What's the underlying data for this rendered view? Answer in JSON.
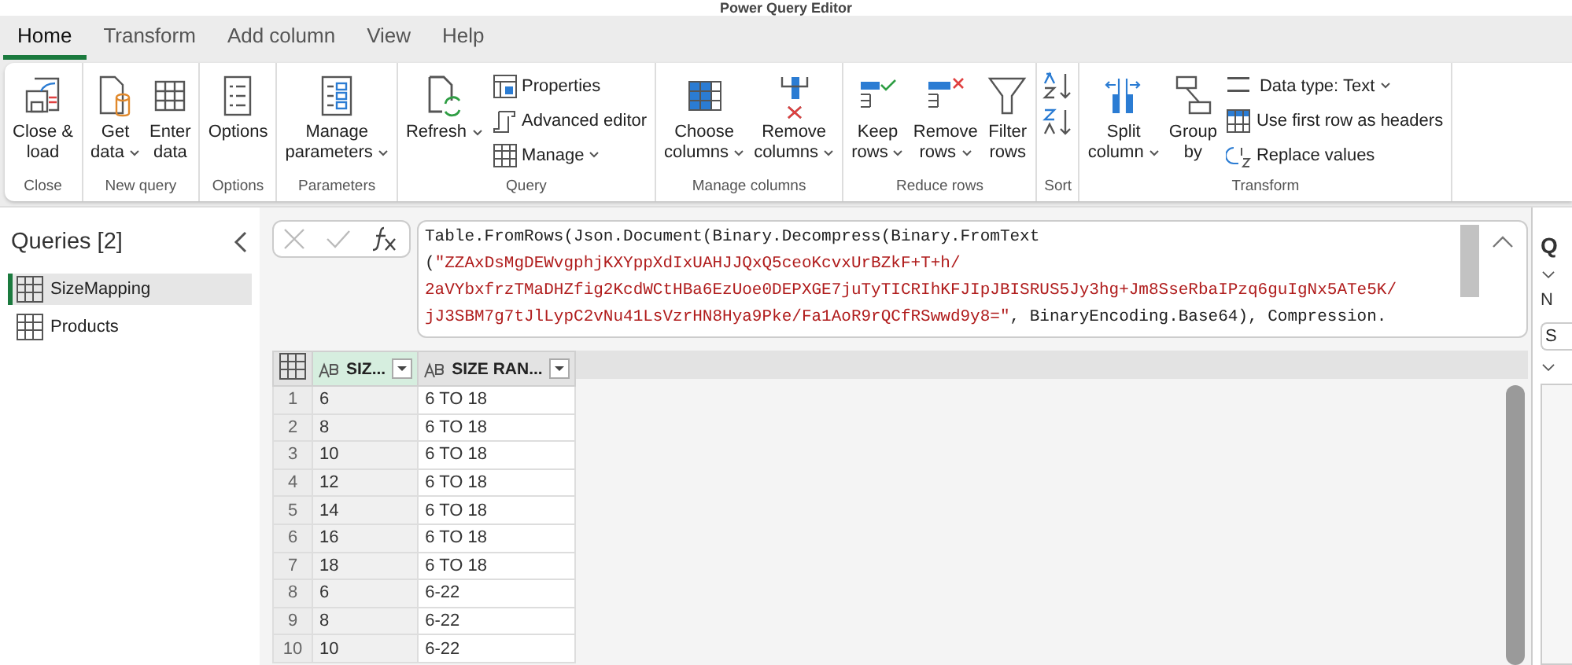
{
  "window": {
    "title": "Power Query Editor"
  },
  "tabs": [
    {
      "label": "Home",
      "selected": true
    },
    {
      "label": "Transform",
      "selected": false
    },
    {
      "label": "Add column",
      "selected": false
    },
    {
      "label": "View",
      "selected": false
    },
    {
      "label": "Help",
      "selected": false
    }
  ],
  "ribbon": [
    {
      "label": "Close",
      "buttons": [
        {
          "kind": "large",
          "label": "Close &\nload",
          "dropdown": false
        }
      ]
    },
    {
      "label": "New query",
      "buttons": [
        {
          "kind": "large",
          "label": "Get\ndata",
          "dropdown": true
        },
        {
          "kind": "large",
          "label": "Enter\ndata",
          "dropdown": false
        }
      ]
    },
    {
      "label": "Options",
      "buttons": [
        {
          "kind": "large",
          "label": "Options",
          "dropdown": false
        }
      ]
    },
    {
      "label": "Parameters",
      "buttons": [
        {
          "kind": "large",
          "label": "Manage\nparameters",
          "dropdown": true
        }
      ]
    },
    {
      "label": "Query",
      "buttons": [
        {
          "kind": "large",
          "label": "Refresh",
          "dropdown": true
        },
        {
          "kind": "small",
          "label": "Properties",
          "dropdown": false
        },
        {
          "kind": "small",
          "label": "Advanced editor",
          "dropdown": false
        },
        {
          "kind": "small",
          "label": "Manage",
          "dropdown": true
        }
      ]
    },
    {
      "label": "Manage columns",
      "buttons": [
        {
          "kind": "large",
          "label": "Choose\ncolumns",
          "dropdown": true
        },
        {
          "kind": "large",
          "label": "Remove\ncolumns",
          "dropdown": true
        }
      ]
    },
    {
      "label": "Reduce rows",
      "buttons": [
        {
          "kind": "large",
          "label": "Keep\nrows",
          "dropdown": true
        },
        {
          "kind": "large",
          "label": "Remove\nrows",
          "dropdown": true
        },
        {
          "kind": "large",
          "label": "Filter\nrows",
          "dropdown": false
        }
      ]
    },
    {
      "label": "Sort",
      "buttons": [
        {
          "kind": "icon"
        },
        {
          "kind": "icon"
        }
      ]
    },
    {
      "label": "Transform",
      "buttons": [
        {
          "kind": "large",
          "label": "Split\ncolumn",
          "dropdown": true
        },
        {
          "kind": "large",
          "label": "Group\nby",
          "dropdown": false
        },
        {
          "kind": "small",
          "label": "Data type: Text",
          "dropdown": true
        },
        {
          "kind": "small",
          "label": "Use first row as headers",
          "dropdown": false
        },
        {
          "kind": "small",
          "label": "Replace values",
          "dropdown": false
        }
      ]
    }
  ],
  "queries": {
    "title": "Queries [2]",
    "items": [
      {
        "label": "SizeMapping",
        "selected": true
      },
      {
        "label": "Products",
        "selected": false
      }
    ]
  },
  "formula": {
    "lines": [
      [
        {
          "kind": "code",
          "text": "Table.FromRows(Json.Document(Binary.Decompress(Binary.FromText"
        }
      ],
      [
        {
          "kind": "code",
          "text": "("
        },
        {
          "kind": "string",
          "text": "\"ZZAxDsMgDEWvgphjKXYppXdIxUAHJJQxQ5ceoKcvxUrBZkF+T+h/"
        }
      ],
      [
        {
          "kind": "string",
          "text": "2aVYbxfrzTMaDHZfig2KcdWCtHBa6EzUoe0DEPXGE7juTyTICRIhKFJIpJBISRUS5Jy3hg+Jm8SseRbaIPzq6guIgNx5ATe5K/"
        }
      ],
      [
        {
          "kind": "string",
          "text": "jJ3SBM7g7tJlLypC2vNu41LsVzrHN8Hya9Pke/Fa1AoR9rQCfRSwwd9y8=\""
        },
        {
          "kind": "code",
          "text": ", BinaryEncoding.Base64), Compression."
        }
      ]
    ]
  },
  "table": {
    "columns": [
      {
        "label": "SIZ...",
        "selected": true
      },
      {
        "label": "SIZE RAN...",
        "selected": false
      }
    ],
    "rows": [
      {
        "number": "1",
        "cells": [
          "6",
          "6 TO 18"
        ]
      },
      {
        "number": "2",
        "cells": [
          "8",
          "6 TO 18"
        ]
      },
      {
        "number": "3",
        "cells": [
          "10",
          "6 TO 18"
        ]
      },
      {
        "number": "4",
        "cells": [
          "12",
          "6 TO 18"
        ]
      },
      {
        "number": "5",
        "cells": [
          "14",
          "6 TO 18"
        ]
      },
      {
        "number": "6",
        "cells": [
          "16",
          "6 TO 18"
        ]
      },
      {
        "number": "7",
        "cells": [
          "18",
          "6 TO 18"
        ]
      },
      {
        "number": "8",
        "cells": [
          "6",
          "6-22"
        ]
      },
      {
        "number": "9",
        "cells": [
          "8",
          "6-22"
        ]
      },
      {
        "number": "10",
        "cells": [
          "10",
          "6-22"
        ]
      }
    ]
  },
  "settings": {
    "title": "Q",
    "name_label": "N",
    "name_value": "S"
  }
}
